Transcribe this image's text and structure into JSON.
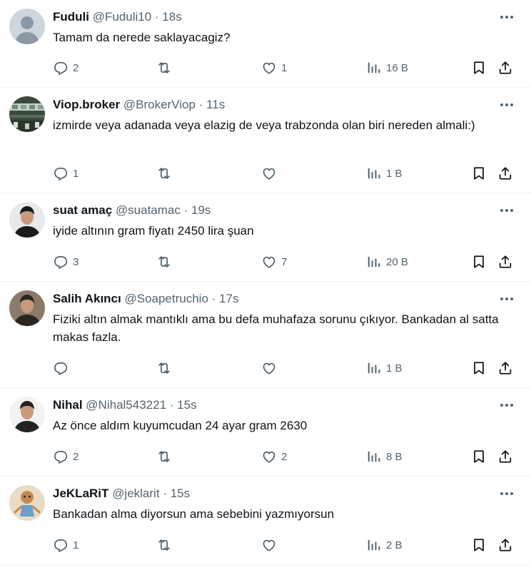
{
  "tweets": [
    {
      "name": "Fuduli",
      "handle": "@Fuduli10",
      "time": "18s",
      "text": "Tamam da nerede saklayacagiz?",
      "replies": "2",
      "retweets": "",
      "likes": "1",
      "views": "16 B",
      "avatar": "default-avatar",
      "avatar_colors": [
        "#ced5dc",
        "#8b98a5"
      ]
    },
    {
      "name": "Viop.broker",
      "handle": "@BrokerViop",
      "time": "11s",
      "text": "izmirde veya adanada veya elazig de veya trabzonda olan biri nereden almali:)",
      "replies": "1",
      "retweets": "",
      "likes": "",
      "views": "1 B",
      "avatar": "trading-floor-photo",
      "avatar_colors": [
        "#3a4a3c",
        "#c7d2c8"
      ]
    },
    {
      "name": "suat amaç",
      "handle": "@suatamac",
      "time": "19s",
      "text": "iyide altının gram fiyatı 2450 lira şuan",
      "replies": "3",
      "retweets": "",
      "likes": "7",
      "views": "20 B",
      "avatar": "portrait-photo",
      "avatar_colors": [
        "#e7e9ea",
        "#1a1a1a"
      ]
    },
    {
      "name": "Salih Akıncı",
      "handle": "@Soapetruchio",
      "time": "17s",
      "text": "Fiziki altın almak mantıklı ama bu defa muhafaza sorunu çıkıyor. Bankadan al satta makas fazla.",
      "replies": "",
      "retweets": "",
      "likes": "",
      "views": "1 B",
      "avatar": "portrait-photo",
      "avatar_colors": [
        "#8a7a6a",
        "#2b2520"
      ]
    },
    {
      "name": "Nihal",
      "handle": "@Nihal543221",
      "time": "15s",
      "text": "Az önce aldım kuyumcudan 24 ayar gram 2630",
      "replies": "2",
      "retweets": "",
      "likes": "2",
      "views": "8 B",
      "avatar": "portrait-photo",
      "avatar_colors": [
        "#f2f2f2",
        "#222222"
      ]
    },
    {
      "name": "JeKLaRiT",
      "handle": "@jeklarit",
      "time": "15s",
      "text": "Bankadan alma diyorsun ama sebebini yazmıyorsun",
      "replies": "1",
      "retweets": "",
      "likes": "",
      "views": "2 B",
      "avatar": "doll-illustration",
      "avatar_colors": [
        "#e9dcc5",
        "#c38a52"
      ]
    }
  ],
  "colors": {
    "text": "#0f1419",
    "secondary": "#536471",
    "divider": "#eff3f4"
  },
  "icons": [
    "reply-icon",
    "retweet-icon",
    "like-icon",
    "views-icon",
    "bookmark-icon",
    "share-icon",
    "more-icon"
  ]
}
